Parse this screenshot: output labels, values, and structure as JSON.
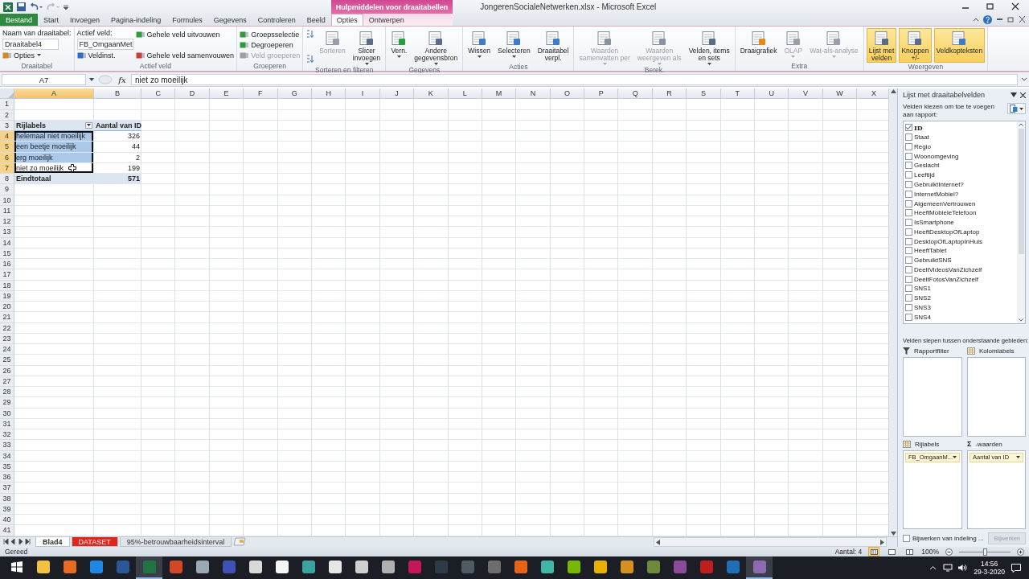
{
  "title_bar": {
    "title": "JongerenSocialeNetwerken.xlsx  -  Microsoft Excel"
  },
  "ribbon_tabs": [
    {
      "label": "Bestand",
      "kind": "file",
      "selected": false
    },
    {
      "label": "Start",
      "kind": "normal",
      "selected": false
    },
    {
      "label": "Invoegen",
      "kind": "normal",
      "selected": false
    },
    {
      "label": "Pagina-indeling",
      "kind": "normal",
      "selected": false
    },
    {
      "label": "Formules",
      "kind": "normal",
      "selected": false
    },
    {
      "label": "Gegevens",
      "kind": "normal",
      "selected": false
    },
    {
      "label": "Controleren",
      "kind": "normal",
      "selected": false
    },
    {
      "label": "Beeld",
      "kind": "normal",
      "selected": false
    }
  ],
  "contextual_group": {
    "title": "Hulpmiddelen voor draaitabellen",
    "tabs": [
      {
        "label": "Opties",
        "selected": true
      },
      {
        "label": "Ontwerpen",
        "selected": false
      }
    ]
  },
  "ribbon_groups": [
    {
      "label": "Draaitabel",
      "columns": [
        {
          "kind": "stack",
          "items": [
            {
              "kind": "text",
              "label": "Naam van draaitabel:"
            },
            {
              "kind": "field",
              "value": "Draaitabel4"
            },
            {
              "kind": "button",
              "label": "Opties",
              "dropdown": true,
              "disabled": false
            }
          ]
        }
      ]
    },
    {
      "label": "Actief veld",
      "columns": [
        {
          "kind": "stack",
          "items": [
            {
              "kind": "text",
              "label": "Actief veld:"
            },
            {
              "kind": "field",
              "value": "FB_OmgaanMet"
            },
            {
              "kind": "button",
              "label": "Veldinst.",
              "dropdown": false,
              "disabled": false
            }
          ]
        },
        {
          "kind": "stack",
          "items": [
            {
              "kind": "button",
              "label": "Gehele veld uitvouwen",
              "dropdown": false,
              "disabled": false
            },
            {
              "kind": "button",
              "label": "Gehele veld samenvouwen",
              "dropdown": false,
              "disabled": false
            }
          ]
        }
      ]
    },
    {
      "label": "Groeperen",
      "columns": [
        {
          "kind": "stack",
          "items": [
            {
              "kind": "button",
              "label": "Groepsselectie",
              "dropdown": false,
              "disabled": false
            },
            {
              "kind": "button",
              "label": "Degroeperen",
              "dropdown": false,
              "disabled": false
            },
            {
              "kind": "button",
              "label": "Veld groeperen",
              "dropdown": false,
              "disabled": true
            }
          ]
        }
      ]
    },
    {
      "label": "Sorteren en filteren",
      "columns": [
        {
          "kind": "stack",
          "items": [
            {
              "kind": "icon-button",
              "disabled": false
            },
            {
              "kind": "icon-button",
              "disabled": false
            }
          ]
        },
        {
          "kind": "large",
          "label": "Sorteren",
          "dropdown": false,
          "disabled": true,
          "active": false
        },
        {
          "kind": "large",
          "label": "Slicer\ninvoegen",
          "dropdown": true,
          "disabled": false,
          "active": false
        }
      ]
    },
    {
      "label": "Gegevens",
      "columns": [
        {
          "kind": "large",
          "label": "Vern.",
          "dropdown": true,
          "disabled": false,
          "active": false
        },
        {
          "kind": "large",
          "label": "Andere\ngegevensbron",
          "dropdown": true,
          "disabled": false,
          "active": false
        }
      ]
    },
    {
      "label": "Acties",
      "columns": [
        {
          "kind": "large",
          "label": "Wissen",
          "dropdown": true,
          "disabled": false,
          "active": false
        },
        {
          "kind": "large",
          "label": "Selecteren",
          "dropdown": true,
          "disabled": false,
          "active": false
        },
        {
          "kind": "large",
          "label": "Draaitabel\nverpl.",
          "dropdown": false,
          "disabled": false,
          "active": false
        }
      ]
    },
    {
      "label": "Berek.",
      "columns": [
        {
          "kind": "large",
          "label": "Waarden\nsamenvatten per",
          "dropdown": true,
          "disabled": true,
          "active": false
        },
        {
          "kind": "large",
          "label": "Waarden\nweergeven als",
          "dropdown": true,
          "disabled": true,
          "active": false
        },
        {
          "kind": "large",
          "label": "Velden, items\nen sets",
          "dropdown": true,
          "disabled": false,
          "active": false
        }
      ]
    },
    {
      "label": "Extra",
      "columns": [
        {
          "kind": "large",
          "label": "Draaigrafiek",
          "dropdown": false,
          "disabled": false,
          "active": false
        },
        {
          "kind": "large",
          "label": "OLAP",
          "dropdown": true,
          "disabled": true,
          "active": false
        },
        {
          "kind": "large",
          "label": "Wat-als-analyse",
          "dropdown": true,
          "disabled": true,
          "active": false
        }
      ]
    },
    {
      "label": "Weergeven",
      "columns": [
        {
          "kind": "large",
          "label": "Lijst met\nvelden",
          "dropdown": false,
          "disabled": false,
          "active": true
        },
        {
          "kind": "large",
          "label": "Knoppen\n+/-",
          "dropdown": false,
          "disabled": false,
          "active": true
        },
        {
          "kind": "large",
          "label": "Veldkopteksten",
          "dropdown": false,
          "disabled": false,
          "active": true
        }
      ]
    }
  ],
  "formula_bar": {
    "name_box": "A7",
    "function_label": "fx",
    "formula": "niet zo moeilijk"
  },
  "sheet": {
    "columns": [
      {
        "label": "A",
        "selected": true
      },
      {
        "label": "B",
        "selected": false
      },
      {
        "label": "C",
        "selected": false
      },
      {
        "label": "D",
        "selected": false
      },
      {
        "label": "E",
        "selected": false
      },
      {
        "label": "F",
        "selected": false
      },
      {
        "label": "G",
        "selected": false
      },
      {
        "label": "H",
        "selected": false
      },
      {
        "label": "I",
        "selected": false
      },
      {
        "label": "J",
        "selected": false
      },
      {
        "label": "K",
        "selected": false
      },
      {
        "label": "L",
        "selected": false
      },
      {
        "label": "M",
        "selected": false
      },
      {
        "label": "N",
        "selected": false
      },
      {
        "label": "O",
        "selected": false
      },
      {
        "label": "P",
        "selected": false
      },
      {
        "label": "Q",
        "selected": false
      },
      {
        "label": "R",
        "selected": false
      },
      {
        "label": "S",
        "selected": false
      },
      {
        "label": "T",
        "selected": false
      },
      {
        "label": "U",
        "selected": false
      },
      {
        "label": "V",
        "selected": false
      },
      {
        "label": "W",
        "selected": false
      },
      {
        "label": "X",
        "selected": false
      }
    ],
    "rows": [
      {
        "number": "1",
        "selected": false
      },
      {
        "number": "2",
        "selected": false
      },
      {
        "number": "3",
        "selected": false,
        "kind": "pivot-header",
        "cells": [
          "Rijlabels",
          "Aantal van ID"
        ]
      },
      {
        "number": "4",
        "selected": true,
        "kind": "pivot-item",
        "active": false,
        "cells": [
          "helemaal niet moeilijk",
          "326"
        ]
      },
      {
        "number": "5",
        "selected": true,
        "kind": "pivot-item",
        "active": false,
        "cells": [
          "een beetje moeilijk",
          "44"
        ]
      },
      {
        "number": "6",
        "selected": true,
        "kind": "pivot-item",
        "active": false,
        "cells": [
          "erg moeilijk",
          "2"
        ]
      },
      {
        "number": "7",
        "selected": true,
        "kind": "pivot-item",
        "active": true,
        "cells": [
          "niet zo moeilijk",
          "199"
        ]
      },
      {
        "number": "8",
        "selected": false,
        "kind": "pivot-total",
        "cells": [
          "Eindtotaal",
          "571"
        ]
      },
      {
        "number": "9",
        "selected": false
      },
      {
        "number": "10",
        "selected": false
      },
      {
        "number": "11",
        "selected": false
      },
      {
        "number": "12",
        "selected": false
      },
      {
        "number": "13",
        "selected": false
      },
      {
        "number": "14",
        "selected": false
      },
      {
        "number": "15",
        "selected": false
      },
      {
        "number": "16",
        "selected": false
      },
      {
        "number": "17",
        "selected": false
      },
      {
        "number": "18",
        "selected": false
      },
      {
        "number": "19",
        "selected": false
      },
      {
        "number": "20",
        "selected": false
      },
      {
        "number": "21",
        "selected": false
      },
      {
        "number": "22",
        "selected": false
      },
      {
        "number": "23",
        "selected": false
      },
      {
        "number": "24",
        "selected": false
      },
      {
        "number": "25",
        "selected": false
      },
      {
        "number": "26",
        "selected": false
      },
      {
        "number": "27",
        "selected": false
      },
      {
        "number": "28",
        "selected": false
      },
      {
        "number": "29",
        "selected": false
      },
      {
        "number": "30",
        "selected": false
      },
      {
        "number": "31",
        "selected": false
      },
      {
        "number": "32",
        "selected": false
      },
      {
        "number": "33",
        "selected": false
      },
      {
        "number": "34",
        "selected": false
      },
      {
        "number": "35",
        "selected": false
      },
      {
        "number": "36",
        "selected": false
      },
      {
        "number": "37",
        "selected": false
      },
      {
        "number": "38",
        "selected": false
      },
      {
        "number": "39",
        "selected": false
      },
      {
        "number": "40",
        "selected": false
      },
      {
        "number": "41",
        "selected": false
      }
    ]
  },
  "sheet_tabs": [
    {
      "label": "Blad4",
      "selected": true
    },
    {
      "label": "DATASET",
      "selected": false,
      "color": "#e3241c"
    },
    {
      "label": "95%-betrouwbaarheidsinterval",
      "selected": false
    }
  ],
  "field_list": {
    "title": "Lijst met draaitabelvelden",
    "choose_label": "Velden kiezen om toe te voegen aan rapport:",
    "fields": [
      {
        "label": "ID",
        "checked": true
      },
      {
        "label": "Staat",
        "checked": false
      },
      {
        "label": "Regio",
        "checked": false
      },
      {
        "label": "Woonomgeving",
        "checked": false
      },
      {
        "label": "Geslacht",
        "checked": false
      },
      {
        "label": "Leeftijd",
        "checked": false
      },
      {
        "label": "GebruiktInternet?",
        "checked": false
      },
      {
        "label": "InternetMobiel?",
        "checked": false
      },
      {
        "label": "AlgemeenVertrouwen",
        "checked": false
      },
      {
        "label": "HeeftMobieleTelefoon",
        "checked": false
      },
      {
        "label": "IsSmartphone",
        "checked": false
      },
      {
        "label": "HeeftDesktopOfLaptop",
        "checked": false
      },
      {
        "label": "DesktopOfLaptopInHuis",
        "checked": false
      },
      {
        "label": "HeeftTablet",
        "checked": false
      },
      {
        "label": "GebruiktSNS",
        "checked": false
      },
      {
        "label": "DeeltVideosVanZichzelf",
        "checked": false
      },
      {
        "label": "DeeltFotosVanZichzelf",
        "checked": false
      },
      {
        "label": "SNS1",
        "checked": false
      },
      {
        "label": "SNS2",
        "checked": false
      },
      {
        "label": "SNS3",
        "checked": false
      },
      {
        "label": "SNS4",
        "checked": false
      }
    ],
    "drag_label": "Velden slepen tussen onderstaande gebieden:",
    "areas": [
      {
        "kind": "filter",
        "label": "Rapportfilter"
      },
      {
        "kind": "columns",
        "label": "Kolomlabels"
      },
      {
        "kind": "rows",
        "label": "Rijlabels",
        "chips": [
          "FB_OmgaanM..."
        ]
      },
      {
        "kind": "values",
        "symbol": "Σ",
        "label": "-waarden",
        "chips": [
          "Aantal van ID"
        ]
      }
    ],
    "defer_update": {
      "label": "Bijwerken van indeling ...",
      "checked": false
    },
    "update_button": {
      "label": "Bijwerken",
      "disabled": true
    }
  },
  "status_bar": {
    "status": "Gereed",
    "count": "Aantal: 4",
    "views": [
      {
        "selected": true
      },
      {
        "selected": false
      },
      {
        "selected": false
      }
    ],
    "zoom": "100%",
    "zoom_level": {
      "level": 0.5
    }
  },
  "taskbar": {
    "apps": [
      {
        "color": "#f3c041",
        "active": false
      },
      {
        "color": "#e66a1f",
        "active": false
      },
      {
        "color": "#1e88e5",
        "active": false
      },
      {
        "color": "#2b5797",
        "active": false
      },
      {
        "color": "#217346",
        "active": true
      },
      {
        "color": "#d24726",
        "active": false
      },
      {
        "color": "#9aa7b5",
        "active": false
      },
      {
        "color": "#3f51b5",
        "active": false
      },
      {
        "color": "#d9d9d9",
        "active": false
      },
      {
        "color": "#f5f5f5",
        "active": false
      },
      {
        "color": "#3aa3a0",
        "active": false
      },
      {
        "color": "#e6e6e6",
        "active": false
      },
      {
        "color": "#cfcfcf",
        "active": false
      },
      {
        "color": "#b0b0b0",
        "active": false
      },
      {
        "color": "#c2185b",
        "active": false
      },
      {
        "color": "#2d3b48",
        "active": false
      },
      {
        "color": "#505a63",
        "active": false
      },
      {
        "color": "#6d6d6d",
        "active": false
      },
      {
        "color": "#e8631a",
        "active": false
      },
      {
        "color": "#3fb6a8",
        "active": false
      },
      {
        "color": "#76b900",
        "active": false
      },
      {
        "color": "#e8b100",
        "active": false
      },
      {
        "color": "#d68f21",
        "active": false
      },
      {
        "color": "#6e8b3d",
        "active": false
      },
      {
        "color": "#8a4b9b",
        "active": false
      },
      {
        "color": "#bf1e1e",
        "active": false
      },
      {
        "color": "#1f6fb2",
        "active": false
      },
      {
        "color": "#8c6bb1",
        "active": true
      }
    ],
    "time": "14:56",
    "date": "29-3-2020"
  }
}
